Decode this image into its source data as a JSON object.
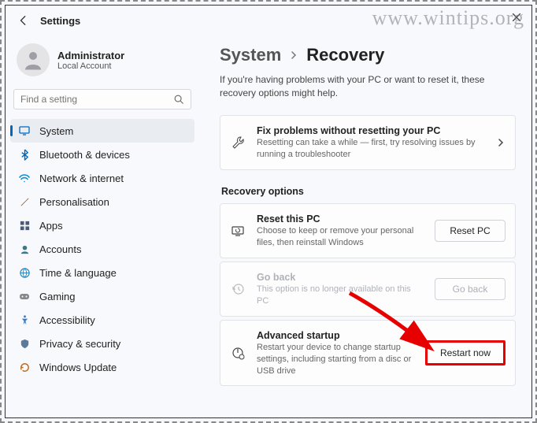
{
  "watermark": "www.wintips.org",
  "header": {
    "title": "Settings"
  },
  "profile": {
    "name": "Administrator",
    "sub": "Local Account"
  },
  "search": {
    "placeholder": "Find a setting"
  },
  "nav": {
    "items": [
      {
        "label": "System"
      },
      {
        "label": "Bluetooth & devices"
      },
      {
        "label": "Network & internet"
      },
      {
        "label": "Personalisation"
      },
      {
        "label": "Apps"
      },
      {
        "label": "Accounts"
      },
      {
        "label": "Time & language"
      },
      {
        "label": "Gaming"
      },
      {
        "label": "Accessibility"
      },
      {
        "label": "Privacy & security"
      },
      {
        "label": "Windows Update"
      }
    ]
  },
  "breadcrumb": {
    "parent": "System",
    "current": "Recovery"
  },
  "description": "If you're having problems with your PC or want to reset it, these recovery options might help.",
  "fix": {
    "title": "Fix problems without resetting your PC",
    "desc": "Resetting can take a while — first, try resolving issues by running a troubleshooter"
  },
  "recovery": {
    "heading": "Recovery options",
    "reset": {
      "title": "Reset this PC",
      "desc": "Choose to keep or remove your personal files, then reinstall Windows",
      "button": "Reset PC"
    },
    "goback": {
      "title": "Go back",
      "desc": "This option is no longer available on this PC",
      "button": "Go back"
    },
    "advanced": {
      "title": "Advanced startup",
      "desc": "Restart your device to change startup settings, including starting from a disc or USB drive",
      "button": "Restart now"
    }
  }
}
